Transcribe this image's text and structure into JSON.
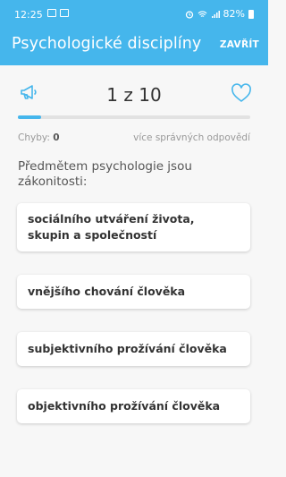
{
  "status_bar": {
    "time": "12:25",
    "battery": "82%",
    "icons": [
      "image-icon",
      "notification-icon",
      "alarm-icon",
      "wifi-icon",
      "signal-icon",
      "battery-icon"
    ]
  },
  "app_bar": {
    "title": "Psychologické disciplíny",
    "close_label": "ZAVŘÍT",
    "color": "#45b6ec"
  },
  "quiz": {
    "counter": "1 z 10",
    "progress": 0.1,
    "errors_label": "Chyby:",
    "errors_value": "0",
    "mode_label": "více správných odpovědí",
    "question": "Předmětem psychologie jsou zákonitosti:",
    "answers": [
      "sociálního utváření života, skupin a společností",
      "vnějšího chování člověka",
      "subjektivního prožívání člověka",
      "objektivního prožívání člověka"
    ],
    "icons": [
      "megaphone-icon",
      "heart-icon"
    ]
  }
}
